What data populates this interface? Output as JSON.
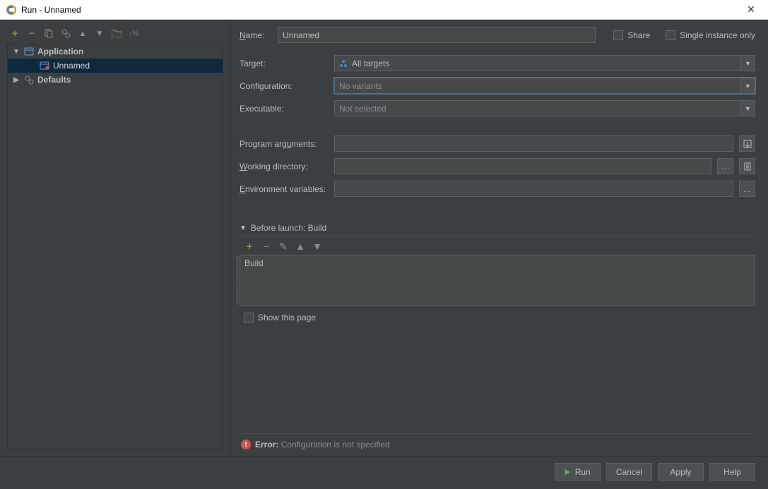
{
  "titlebar": {
    "title": "Run - Unnamed"
  },
  "sidebar": {
    "groups": [
      {
        "label": "Application",
        "expanded": true
      },
      {
        "label": "Defaults",
        "expanded": false
      }
    ],
    "items": [
      {
        "label": "Unnamed"
      }
    ]
  },
  "form": {
    "name_label": "Name:",
    "name_value": "Unnamed",
    "share_label": "Share",
    "single_instance_label": "Single instance only",
    "target_label": "Target:",
    "target_value": "All targets",
    "configuration_label": "Configuration:",
    "configuration_value": "No variants",
    "executable_label": "Executable:",
    "executable_value": "Not selected",
    "program_args_label": "Program arguments:",
    "program_args_value": "",
    "working_dir_label": "Working directory:",
    "working_dir_value": "",
    "env_vars_label": "Environment variables:",
    "env_vars_value": ""
  },
  "before_launch": {
    "header": "Before launch: Build",
    "items": [
      "Build"
    ],
    "show_page_label": "Show this page"
  },
  "status": {
    "error_label": "Error:",
    "error_message": "Configuration is not specified"
  },
  "footer": {
    "run": "Run",
    "cancel": "Cancel",
    "apply": "Apply",
    "help": "Help"
  }
}
